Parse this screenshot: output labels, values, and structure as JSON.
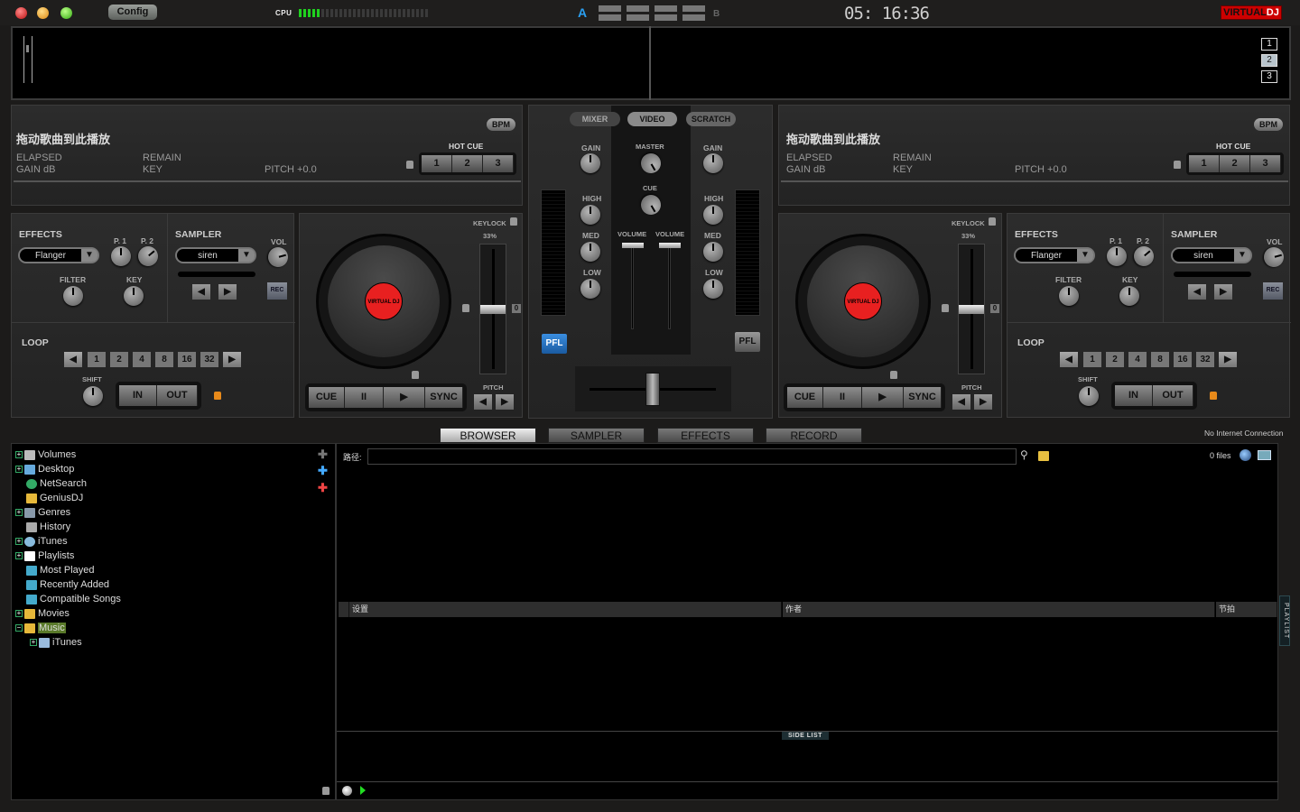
{
  "topbar": {
    "config_label": "Config",
    "cpu_label": "CPU",
    "cpu_load_segments_on": 5,
    "cpu_total_segments": 29,
    "crossfader_a": "A",
    "crossfader_b": "B",
    "clock": "05: 16:36",
    "logo_virtual": "VIRTUAL",
    "logo_dj": "DJ"
  },
  "waveform": {
    "zoom_buttons": [
      "1",
      "2",
      "3"
    ],
    "active_zoom": "2"
  },
  "deck_left": {
    "title": "拖动歌曲到此播放",
    "bpm_label": "BPM",
    "elapsed_label": "ELAPSED",
    "remain_label": "REMAIN",
    "gain_label": "GAIN dB",
    "key_label": "KEY",
    "pitch_label": "PITCH +0.0",
    "hot_cue_label": "HOT CUE",
    "hot_cues": [
      "1",
      "2",
      "3"
    ],
    "effects_label": "EFFECTS",
    "effect_selected": "Flanger",
    "p1_label": "P. 1",
    "p2_label": "P. 2",
    "filter_label": "FILTER",
    "fx_key_label": "KEY",
    "sampler_label": "SAMPLER",
    "sampler_selected": "siren",
    "vol_label": "VOL",
    "rec_label": "REC",
    "loop_label": "LOOP",
    "loop_sizes": [
      "1",
      "2",
      "4",
      "8",
      "16",
      "32"
    ],
    "shift_label": "SHIFT",
    "in_label": "IN",
    "out_label": "OUT",
    "keylock_label": "KEYLOCK",
    "keylock_percent": "33%",
    "pitch_zero": "0",
    "pitch_ctl_label": "PITCH",
    "cue_label": "CUE",
    "pause_label": "II",
    "play_label": "▶",
    "sync_label": "SYNC",
    "platter_logo": "VIRTUAL DJ"
  },
  "deck_right": {
    "title": "拖动歌曲到此播放",
    "bpm_label": "BPM",
    "elapsed_label": "ELAPSED",
    "remain_label": "REMAIN",
    "gain_label": "GAIN dB",
    "key_label": "KEY",
    "pitch_label": "PITCH +0.0",
    "hot_cue_label": "HOT CUE",
    "hot_cues": [
      "1",
      "2",
      "3"
    ],
    "effects_label": "EFFECTS",
    "effect_selected": "Flanger",
    "p1_label": "P. 1",
    "p2_label": "P. 2",
    "filter_label": "FILTER",
    "fx_key_label": "KEY",
    "sampler_label": "SAMPLER",
    "sampler_selected": "siren",
    "vol_label": "VOL",
    "rec_label": "REC",
    "loop_label": "LOOP",
    "loop_sizes": [
      "1",
      "2",
      "4",
      "8",
      "16",
      "32"
    ],
    "shift_label": "SHIFT",
    "in_label": "IN",
    "out_label": "OUT",
    "keylock_label": "KEYLOCK",
    "keylock_percent": "33%",
    "pitch_zero": "0",
    "pitch_ctl_label": "PITCH",
    "cue_label": "CUE",
    "pause_label": "II",
    "play_label": "▶",
    "sync_label": "SYNC",
    "platter_logo": "VIRTUAL DJ"
  },
  "mixer": {
    "tabs": [
      "MIXER",
      "VIDEO",
      "SCRATCH"
    ],
    "active_tab": "VIDEO",
    "gain_label": "GAIN",
    "master_label": "MASTER",
    "cue_label": "CUE",
    "high_label": "HIGH",
    "med_label": "MED",
    "low_label": "LOW",
    "volume_label": "VOLUME",
    "pfl_label": "PFL",
    "pfl_left_active": true,
    "pfl_right_active": false,
    "crossfader_position": 0.5
  },
  "browser": {
    "tabs": [
      "BROWSER",
      "SAMPLER",
      "EFFECTS",
      "RECORD"
    ],
    "active_tab": "BROWSER",
    "connection_status": "No Internet Connection",
    "path_label": "路径:",
    "path_value": "",
    "file_count": "0 files",
    "tree": [
      {
        "label": "Volumes",
        "expand": "+",
        "icon": "drive-icon",
        "depth": 0
      },
      {
        "label": "Desktop",
        "expand": "+",
        "icon": "desktop-icon",
        "depth": 0
      },
      {
        "label": "NetSearch",
        "expand": "",
        "icon": "globe-icon",
        "depth": 0
      },
      {
        "label": "GeniusDJ",
        "expand": "",
        "icon": "genius-folder-icon",
        "depth": 0
      },
      {
        "label": "Genres",
        "expand": "+",
        "icon": "list-icon",
        "depth": 0
      },
      {
        "label": "History",
        "expand": "",
        "icon": "book-icon",
        "depth": 0
      },
      {
        "label": "iTunes",
        "expand": "+",
        "icon": "itunes-icon",
        "depth": 0
      },
      {
        "label": "Playlists",
        "expand": "+",
        "icon": "page-icon",
        "depth": 0
      },
      {
        "label": "Most Played",
        "expand": "",
        "icon": "smart-folder-icon",
        "depth": 0
      },
      {
        "label": "Recently Added",
        "expand": "",
        "icon": "smart-folder-icon",
        "depth": 0
      },
      {
        "label": "Compatible Songs",
        "expand": "",
        "icon": "smart-folder-icon",
        "depth": 0
      },
      {
        "label": "Movies",
        "expand": "+",
        "icon": "star-folder-icon",
        "depth": 0
      },
      {
        "label": "Music",
        "expand": "−",
        "icon": "star-folder-icon",
        "depth": 0,
        "selected": true
      },
      {
        "label": "iTunes",
        "expand": "+",
        "icon": "folder-icon",
        "depth": 1
      }
    ],
    "columns": [
      "设置",
      "作者",
      "节拍"
    ],
    "side_list_label": "SIDE LIST",
    "playlist_label": "PLAYLIST"
  },
  "colors": {
    "accent_blue": "#2a9ff0",
    "cpu_green": "#1fd11f",
    "logo_red": "#cc0000",
    "platter_red": "#e82020",
    "lock_orange": "#e88a1a",
    "selected_green": "#5a7a2a"
  }
}
